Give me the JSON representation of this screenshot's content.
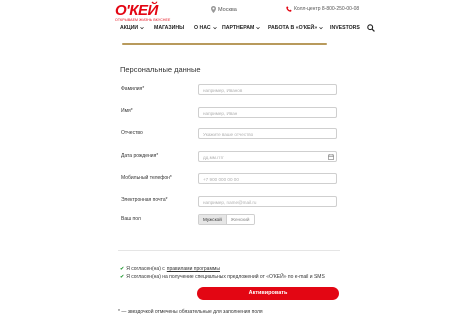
{
  "header": {
    "logo": "О'КЕЙ",
    "logo_sub": "ОТКРЫВАЕМ ЖИЗНЬ ВКУСНЕЕ",
    "city": "Москва",
    "phone": "Колл-центр 8-800-250-00-08"
  },
  "nav": {
    "items": [
      {
        "label": "АКЦИИ",
        "dropdown": true
      },
      {
        "label": "МАГАЗИНЫ",
        "dropdown": false
      },
      {
        "label": "О НАС",
        "dropdown": true
      },
      {
        "label": "ПАРТНЕРАМ",
        "dropdown": true
      },
      {
        "label": "РАБОТА В «О'КЕЙ»",
        "dropdown": true
      },
      {
        "label": "INVESTORS",
        "dropdown": false
      }
    ]
  },
  "form": {
    "title": "Персональные данные",
    "fields": {
      "surname": {
        "label": "Фамилия*",
        "placeholder": "например, Иванов"
      },
      "name": {
        "label": "Имя*",
        "placeholder": "например, Иван"
      },
      "patronymic": {
        "label": "Отчество",
        "placeholder": "Укажите ваше отчество"
      },
      "birthdate": {
        "label": "Дата рождения*",
        "placeholder": "дд.мм.гггг"
      },
      "phone": {
        "label": "Мобильный телефон*",
        "placeholder": "+7 900 000 00 00"
      },
      "email": {
        "label": "Электронная почта*",
        "placeholder": "например, name@mail.ru"
      }
    },
    "gender": {
      "label": "Ваш пол",
      "options": [
        "Мужской",
        "Женский"
      ],
      "selected": "Мужской"
    }
  },
  "consent": {
    "line1_prefix": "Я согласен(на) с",
    "line1_link": "правилами программы",
    "line2": "Я согласен(на) на получение специальных предложений от «О'КЕЙ» по e-mail и SMS"
  },
  "submit_label": "Активировать",
  "footnote": "* — звездочкой отмечены обязательные для заполнения поля",
  "colors": {
    "brand": "#e30613",
    "accent_bar": "#b89a5c",
    "check": "#2a9d3a"
  }
}
